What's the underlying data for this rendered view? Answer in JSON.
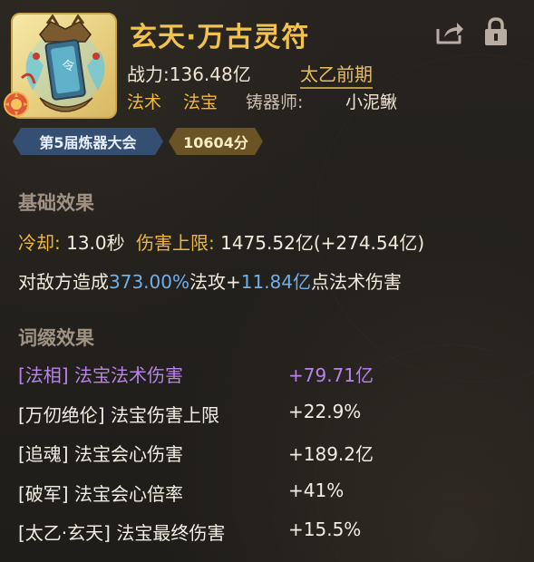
{
  "item": {
    "title": "玄天·万古灵符",
    "power_label": "战力:",
    "power_value": "136.48亿",
    "realm": "太乙前期",
    "tag1": "法术",
    "tag2": "法宝",
    "maker_label": "铸器师:",
    "maker_name": "小泥鳅",
    "event_badge": "第5届炼器大会",
    "score_badge": "10604分"
  },
  "icons": {
    "share": "share-icon",
    "lock": "lock-icon",
    "item": "talisman-artifact-icon",
    "quality": "quality-flame-badge-icon"
  },
  "basic": {
    "title": "基础效果",
    "cooldown_label": "冷却:",
    "cooldown_value": "13.0秒",
    "cap_label": "伤害上限:",
    "cap_value": "1475.52亿(+274.54亿)",
    "desc_prefix": "对敌方造成",
    "desc_percent": "373.00%",
    "desc_mid": "法攻+",
    "desc_flat": "11.84亿",
    "desc_suffix": "点法术伤害"
  },
  "affix": {
    "title": "词缀效果",
    "items": [
      {
        "name": "[法相] 法宝法术伤害",
        "value": "+79.71亿"
      },
      {
        "name": "[万仞绝伦] 法宝伤害上限",
        "value": "+22.9%"
      },
      {
        "name": "[追魂] 法宝会心伤害",
        "value": "+189.2亿"
      },
      {
        "name": "[破军] 法宝会心倍率",
        "value": "+41%"
      },
      {
        "name": "[太乙·玄天] 法宝最终伤害",
        "value": "+15.5%"
      }
    ]
  },
  "colors": {
    "title_gold": "#f3c24d",
    "tag_orange": "#f0b73b",
    "highlight_blue": "#6fb0ea",
    "affix_purple": "#b784e8",
    "badge_blue": "#354f72",
    "badge_gold": "#6a5324"
  }
}
